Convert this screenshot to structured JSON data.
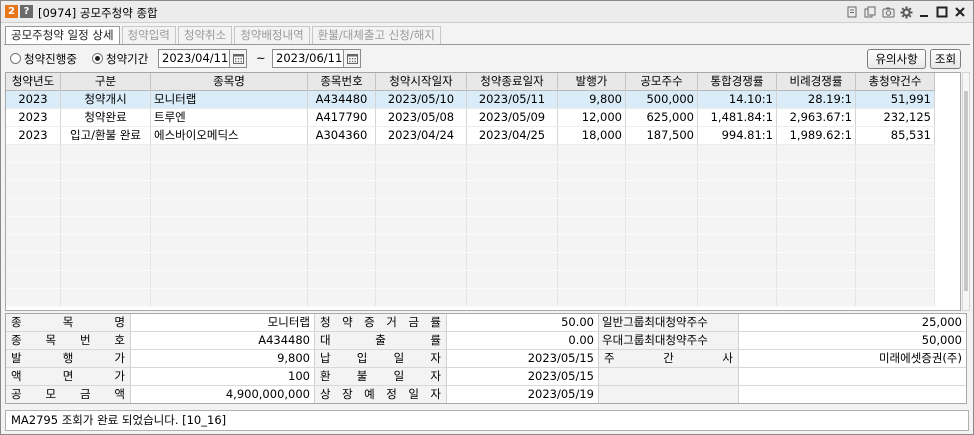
{
  "window": {
    "number_badge": "2",
    "help_badge": "?",
    "title": "[0974] 공모주청약 종합",
    "icons": [
      "memo-icon",
      "copy-icon",
      "camera-icon",
      "gear-icon",
      "minimize-icon",
      "maximize-icon",
      "close-icon"
    ]
  },
  "tabs": [
    {
      "label": "공모주청약 일정 상세",
      "active": true
    },
    {
      "label": "청약입력",
      "active": false
    },
    {
      "label": "청약취소",
      "active": false
    },
    {
      "label": "청약배정내역",
      "active": false
    },
    {
      "label": "환불/대체출고 신청/해지",
      "active": false
    }
  ],
  "filter": {
    "radio_in_progress": "청약진행중",
    "radio_period": "청약기간",
    "selected": "청약기간",
    "date_from": "2023/04/11",
    "tilde": "~",
    "date_to": "2023/06/11",
    "notice_button": "유의사항",
    "search_button": "조회"
  },
  "grid": {
    "columns": [
      "청약년도",
      "구분",
      "종목명",
      "종목번호",
      "청약시작일자",
      "청약종료일자",
      "발행가",
      "공모주수",
      "통합경쟁률",
      "비례경쟁률",
      "총청약건수"
    ],
    "rows": [
      [
        "2023",
        "청약개시",
        "모니터랩",
        "A434480",
        "2023/05/10",
        "2023/05/11",
        "9,800",
        "500,000",
        "14.10:1",
        "28.19:1",
        "51,991"
      ],
      [
        "2023",
        "청약완료",
        "트루엔",
        "A417790",
        "2023/05/08",
        "2023/05/09",
        "12,000",
        "625,000",
        "1,481.84:1",
        "2,963.67:1",
        "232,125"
      ],
      [
        "2023",
        "입고/환불 완료",
        "에스바이오메딕스",
        "A304360",
        "2023/04/24",
        "2023/04/25",
        "18,000",
        "187,500",
        "994.81:1",
        "1,989.62:1",
        "85,531"
      ]
    ],
    "selected_row": 0
  },
  "detail": {
    "row1": {
      "l1": "종목명",
      "v1": "모니터랩",
      "l2": "청약증거금률",
      "v2": "50.00",
      "l3": "일반그룹최대청약주수",
      "v3": "25,000"
    },
    "row2": {
      "l1": "종목번호",
      "v1": "A434480",
      "l2": "대출률",
      "v2": "0.00",
      "l3": "우대그룹최대청약주수",
      "v3": "50,000"
    },
    "row3": {
      "l1": "발행가",
      "v1": "9,800",
      "l2": "납입일자",
      "v2": "2023/05/15",
      "l3": "주간사",
      "v3": "미래에셋증권(주)"
    },
    "row4": {
      "l1": "액면가",
      "v1": "100",
      "l2": "환불일자",
      "v2": "2023/05/15"
    },
    "row5": {
      "l1": "공모금액",
      "v1": "4,900,000,000",
      "l2": "상장예정일자",
      "v2": "2023/05/19"
    }
  },
  "status": {
    "message": "MA2795 조회가 완료 되었습니다. [10_16]"
  }
}
